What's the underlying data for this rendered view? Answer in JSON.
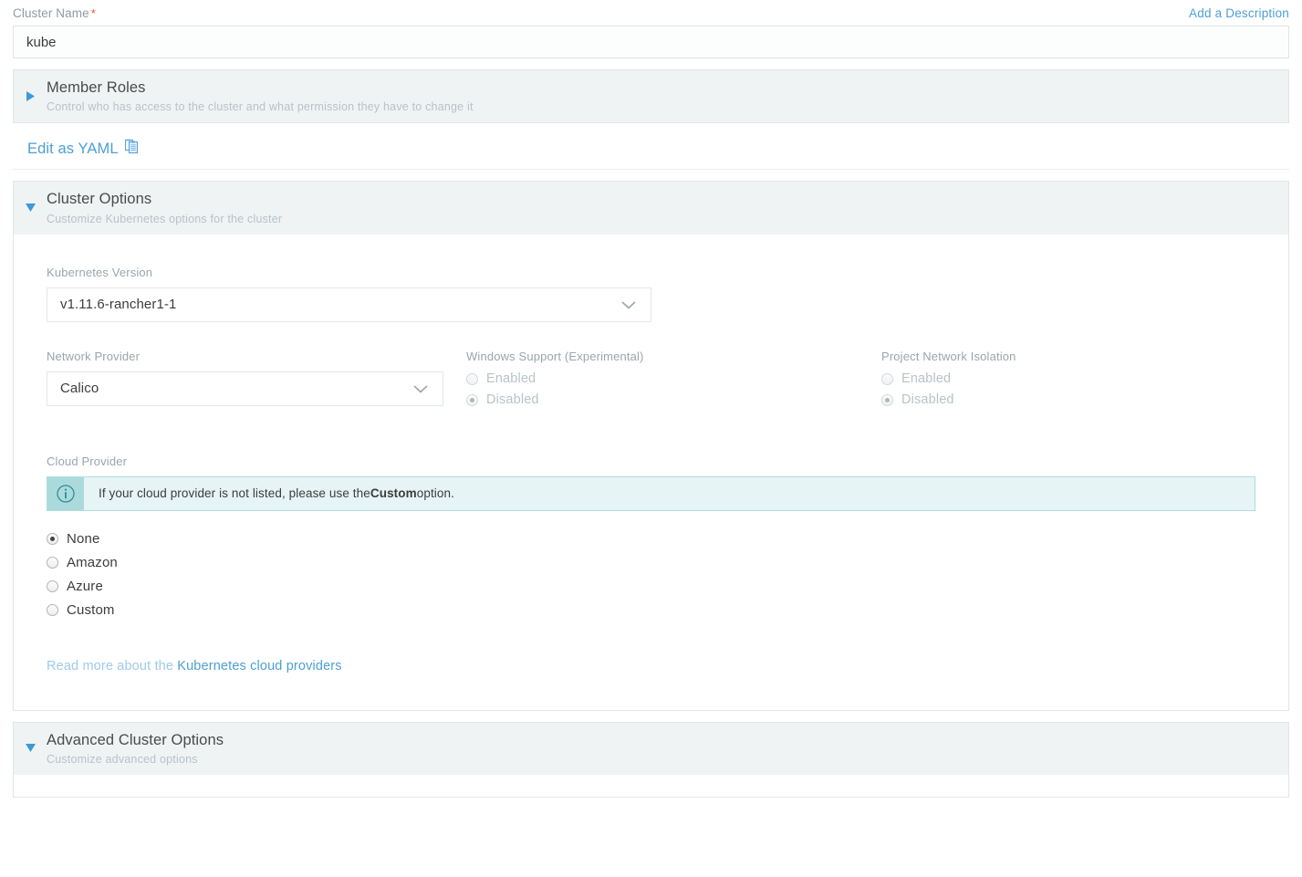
{
  "cluster_name": {
    "label": "Cluster Name",
    "required_marker": "*",
    "value": "kube",
    "placeholder": "",
    "add_description_link": "Add a Description"
  },
  "member_roles": {
    "title": "Member Roles",
    "subtitle": "Control who has access to the cluster and what permission they have to change it",
    "expanded": false,
    "arrow_icon": "triangle-right-icon"
  },
  "yaml": {
    "label": "Edit as YAML",
    "icon": "clipboard-copy-icon"
  },
  "cluster_options": {
    "title": "Cluster Options",
    "subtitle": "Customize Kubernetes options for the cluster",
    "expanded": true,
    "arrow_icon": "triangle-down-icon",
    "kubernetes_version": {
      "label": "Kubernetes Version",
      "value": "v1.11.6-rancher1-1"
    },
    "network_provider": {
      "label": "Network Provider",
      "value": "Calico"
    },
    "windows_support": {
      "label": "Windows Support (Experimental)",
      "options": [
        {
          "label": "Enabled",
          "selected": false,
          "disabled": true
        },
        {
          "label": "Disabled",
          "selected": true,
          "disabled": true
        }
      ]
    },
    "project_network_isolation": {
      "label": "Project Network Isolation",
      "options": [
        {
          "label": "Enabled",
          "selected": false,
          "disabled": true
        },
        {
          "label": "Disabled",
          "selected": true,
          "disabled": true
        }
      ]
    },
    "cloud_provider": {
      "label": "Cloud Provider",
      "banner": {
        "icon": "info-circle-icon",
        "text_before": "If your cloud provider is not listed, please use the ",
        "text_bold": "Custom",
        "text_after": " option."
      },
      "options": [
        {
          "label": "None",
          "selected": true
        },
        {
          "label": "Amazon",
          "selected": false
        },
        {
          "label": "Azure",
          "selected": false
        },
        {
          "label": "Custom",
          "selected": false
        }
      ],
      "read_more_prefix": "Read more about the ",
      "read_more_link": "Kubernetes cloud providers"
    }
  },
  "advanced_cluster_options": {
    "title": "Advanced Cluster Options",
    "subtitle": "Customize advanced options",
    "expanded": true,
    "arrow_icon": "triangle-down-icon"
  },
  "colors": {
    "link": "#4d9ed5",
    "accordion_header_bg": "#eff3f4",
    "banner_bg": "#e6f4f5",
    "banner_icon_bg": "#abdadd",
    "required": "#e8562f"
  }
}
